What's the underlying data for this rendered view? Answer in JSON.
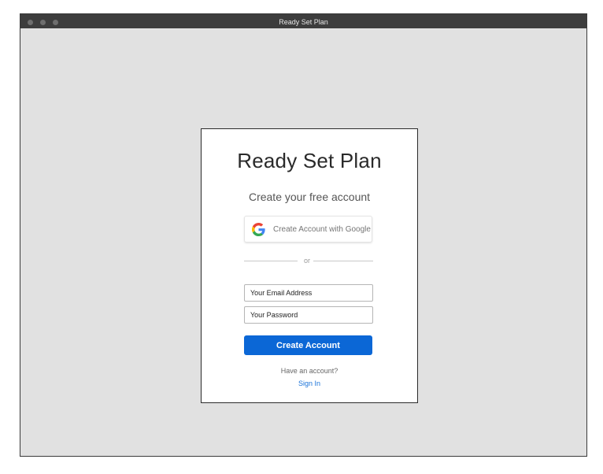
{
  "window": {
    "title": "Ready Set Plan"
  },
  "card": {
    "app_title": "Ready Set Plan",
    "subtitle": "Create your free account",
    "google_button": {
      "label": "Create Account with Google",
      "icon": "google-g-logo"
    },
    "divider_text": "or",
    "email_field": {
      "placeholder": "Your Email Address",
      "value": ""
    },
    "password_field": {
      "placeholder": "Your Password",
      "value": ""
    },
    "submit_label": "Create Account",
    "have_account_text": "Have an account?",
    "sign_in_label": "Sign In"
  },
  "colors": {
    "primary": "#0b67d6",
    "link": "#1a73d9",
    "background": "#e1e1e1",
    "titlebar": "#3d3d3d"
  }
}
